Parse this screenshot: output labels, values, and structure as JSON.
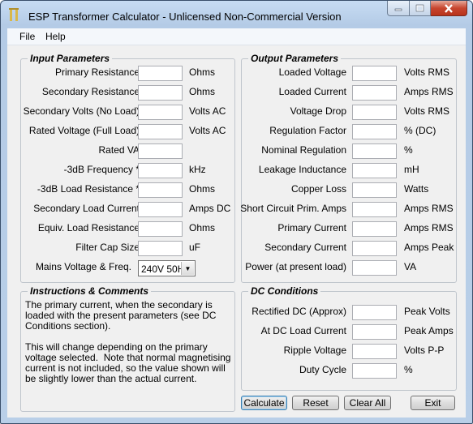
{
  "window": {
    "title": "ESP Transformer Calculator - Unlicensed Non-Commercial Version"
  },
  "menu": {
    "file": "File",
    "help": "Help"
  },
  "input": {
    "legend": "Input Parameters",
    "rows": [
      {
        "label": "Primary Resistance",
        "unit": "Ohms"
      },
      {
        "label": "Secondary Resistance",
        "unit": "Ohms"
      },
      {
        "label": "Secondary Volts (No Load)",
        "unit": "Volts AC"
      },
      {
        "label": "Rated Voltage (Full Load)",
        "unit": "Volts AC"
      },
      {
        "label": "Rated VA",
        "unit": ""
      },
      {
        "label": "-3dB Frequency *",
        "unit": "kHz"
      },
      {
        "label": "-3dB Load Resistance *",
        "unit": "Ohms"
      },
      {
        "label": "Secondary Load Current",
        "unit": "Amps DC"
      },
      {
        "label": "Equiv. Load Resistance",
        "unit": "Ohms"
      },
      {
        "label": "Filter Cap Size",
        "unit": "uF"
      }
    ],
    "mains_label": "Mains Voltage & Freq.",
    "mains_value": "240V 50Hz"
  },
  "output": {
    "legend": "Output Parameters",
    "rows": [
      {
        "label": "Loaded Voltage",
        "unit": "Volts RMS"
      },
      {
        "label": "Loaded Current",
        "unit": "Amps RMS"
      },
      {
        "label": "Voltage Drop",
        "unit": "Volts RMS"
      },
      {
        "label": "Regulation Factor",
        "unit": "% (DC)"
      },
      {
        "label": "Nominal Regulation",
        "unit": "%"
      },
      {
        "label": "Leakage Inductance",
        "unit": "mH"
      },
      {
        "label": "Copper Loss",
        "unit": "Watts"
      },
      {
        "label": "Short Circuit Prim. Amps",
        "unit": "Amps RMS"
      },
      {
        "label": "Primary Current",
        "unit": "Amps RMS"
      },
      {
        "label": "Secondary Current",
        "unit": "Amps Peak"
      },
      {
        "label": "Power (at present load)",
        "unit": "VA"
      }
    ]
  },
  "instructions": {
    "legend": "Instructions & Comments",
    "text": "The primary current, when the secondary is loaded with the present parameters (see DC Conditions section).\n\nThis will change depending on the primary voltage selected.  Note that normal magnetising current is not included, so the value shown will be slightly lower than the actual current."
  },
  "dc": {
    "legend": "DC Conditions",
    "rows": [
      {
        "label": "Rectified DC (Approx)",
        "unit": "Peak Volts"
      },
      {
        "label": "At DC Load Current",
        "unit": "Peak Amps"
      },
      {
        "label": "Ripple Voltage",
        "unit": "Volts P-P"
      },
      {
        "label": "Duty Cycle",
        "unit": "%"
      }
    ]
  },
  "buttons": {
    "calculate": "Calculate",
    "reset": "Reset",
    "clear_all": "Clear All",
    "exit": "Exit"
  }
}
